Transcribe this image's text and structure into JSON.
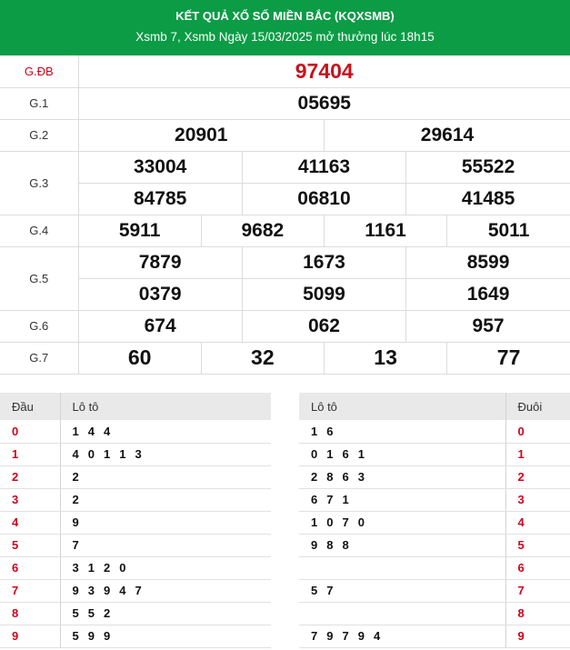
{
  "header": {
    "title": "KẾT QUẢ XỔ SỐ MIỀN BẮC (KQXSMB)",
    "subtitle": "Xsmb 7, Xsmb Ngày 15/03/2025 mở thưởng lúc 18h15"
  },
  "prizes": {
    "special": {
      "label": "G.ĐB",
      "numbers": [
        "97404"
      ]
    },
    "g1": {
      "label": "G.1",
      "numbers": [
        "05695"
      ]
    },
    "g2": {
      "label": "G.2",
      "numbers": [
        "20901",
        "29614"
      ]
    },
    "g3": {
      "label": "G.3",
      "numbers": [
        "33004",
        "41163",
        "55522",
        "84785",
        "06810",
        "41485"
      ]
    },
    "g4": {
      "label": "G.4",
      "numbers": [
        "5911",
        "9682",
        "1161",
        "5011"
      ]
    },
    "g5": {
      "label": "G.5",
      "numbers": [
        "7879",
        "1673",
        "8599",
        "0379",
        "5099",
        "1649"
      ]
    },
    "g6": {
      "label": "G.6",
      "numbers": [
        "674",
        "062",
        "957"
      ]
    },
    "g7": {
      "label": "G.7",
      "numbers": [
        "60",
        "32",
        "13",
        "77"
      ]
    }
  },
  "loto_head": {
    "header_key": "Đầu",
    "header_vals": "Lô tô",
    "rows": [
      {
        "key": "0",
        "vals": "1 4 4"
      },
      {
        "key": "1",
        "vals": "4 0 1 1 3"
      },
      {
        "key": "2",
        "vals": "2"
      },
      {
        "key": "3",
        "vals": "2"
      },
      {
        "key": "4",
        "vals": "9"
      },
      {
        "key": "5",
        "vals": "7"
      },
      {
        "key": "6",
        "vals": "3 1 2 0"
      },
      {
        "key": "7",
        "vals": "9 3 9 4 7"
      },
      {
        "key": "8",
        "vals": "5 5 2"
      },
      {
        "key": "9",
        "vals": "5 9 9"
      }
    ]
  },
  "loto_tail": {
    "header_vals": "Lô tô",
    "header_key": "Đuôi",
    "rows": [
      {
        "vals": "1 6",
        "key": "0"
      },
      {
        "vals": "0 1 6 1",
        "key": "1"
      },
      {
        "vals": "2 8 6 3",
        "key": "2"
      },
      {
        "vals": "6 7 1",
        "key": "3"
      },
      {
        "vals": "1 0 7 0",
        "key": "4"
      },
      {
        "vals": "9 8 8",
        "key": "5"
      },
      {
        "vals": "",
        "key": "6"
      },
      {
        "vals": "5 7",
        "key": "7"
      },
      {
        "vals": "",
        "key": "8"
      },
      {
        "vals": "7 9 7 9 4",
        "key": "9"
      }
    ]
  }
}
